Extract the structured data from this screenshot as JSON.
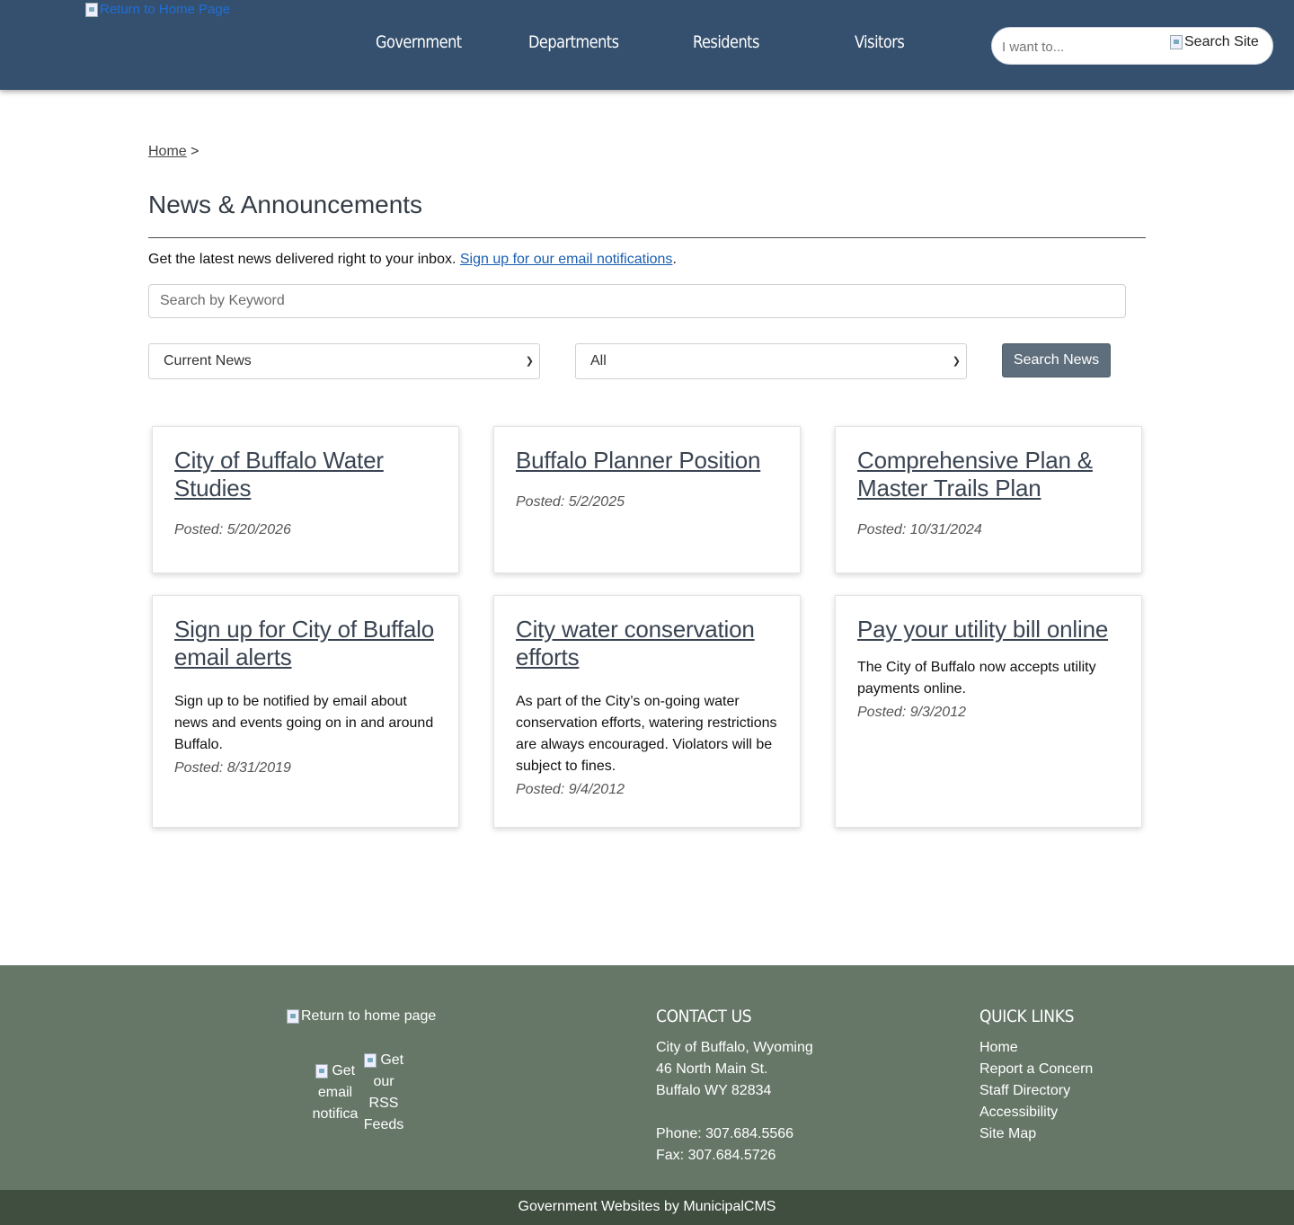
{
  "header": {
    "logo_alt": "Return to Home Page",
    "nav": [
      "Government",
      "Departments",
      "Residents",
      "Visitors"
    ],
    "search_placeholder": "I want to...",
    "search_button_alt": "Search Site"
  },
  "breadcrumb": {
    "home": "Home",
    "separator": ">"
  },
  "page": {
    "title": "News & Announcements",
    "intro_text": "Get the latest news delivered right to your inbox.",
    "intro_link": "Sign up for our email notifications",
    "intro_end": "."
  },
  "filters": {
    "keyword_placeholder": "Search by Keyword",
    "category_selected": "Current News",
    "type_selected": "All",
    "search_button": "Search News"
  },
  "news": [
    {
      "title": "City of Buffalo Water Studies",
      "summary": "",
      "posted": "Posted: 5/20/2026"
    },
    {
      "title": "Buffalo Planner Position",
      "summary": "",
      "posted": "Posted: 5/2/2025"
    },
    {
      "title": "Comprehensive Plan & Master Trails Plan",
      "summary": "",
      "posted": "Posted: 10/31/2024"
    },
    {
      "title": "Sign up for City of Buffalo email alerts",
      "summary": "Sign up to be notified by email about news and events going on in and around Buffalo.",
      "posted": "Posted: 8/31/2019"
    },
    {
      "title": "City water conservation efforts",
      "summary": "As part of the City’s on-going water conservation efforts, watering restrictions are always encouraged. Violators will be subject to fines.",
      "posted": "Posted: 9/4/2012"
    },
    {
      "title": "Pay your utility bill online",
      "summary": "The City of Buffalo now accepts utility payments online.",
      "posted": "Posted: 9/3/2012"
    }
  ],
  "footer": {
    "logo_alt": "Return to home page",
    "email_icon_alt": "Get email notifica",
    "rss_icon_alt": "Get our RSS Feeds",
    "contact": {
      "heading": "CONTACT US",
      "name": "City of Buffalo, Wyoming",
      "street": "46 North Main St.",
      "city": "Buffalo WY 82834",
      "phone": "Phone: 307.684.5566",
      "fax": "Fax: 307.684.5726"
    },
    "quick_links": {
      "heading": "QUICK LINKS",
      "items": [
        "Home",
        "Report a Concern",
        "Staff Directory",
        "Accessibility",
        "Site Map"
      ]
    }
  },
  "bottom_bar": "Government Websites by MunicipalCMS",
  "colors": {
    "header": "#35506e",
    "footer": "#667767",
    "bottom_bar": "#3f4e3f",
    "link": "#1a5fb4",
    "button": "#5f6e7c"
  }
}
